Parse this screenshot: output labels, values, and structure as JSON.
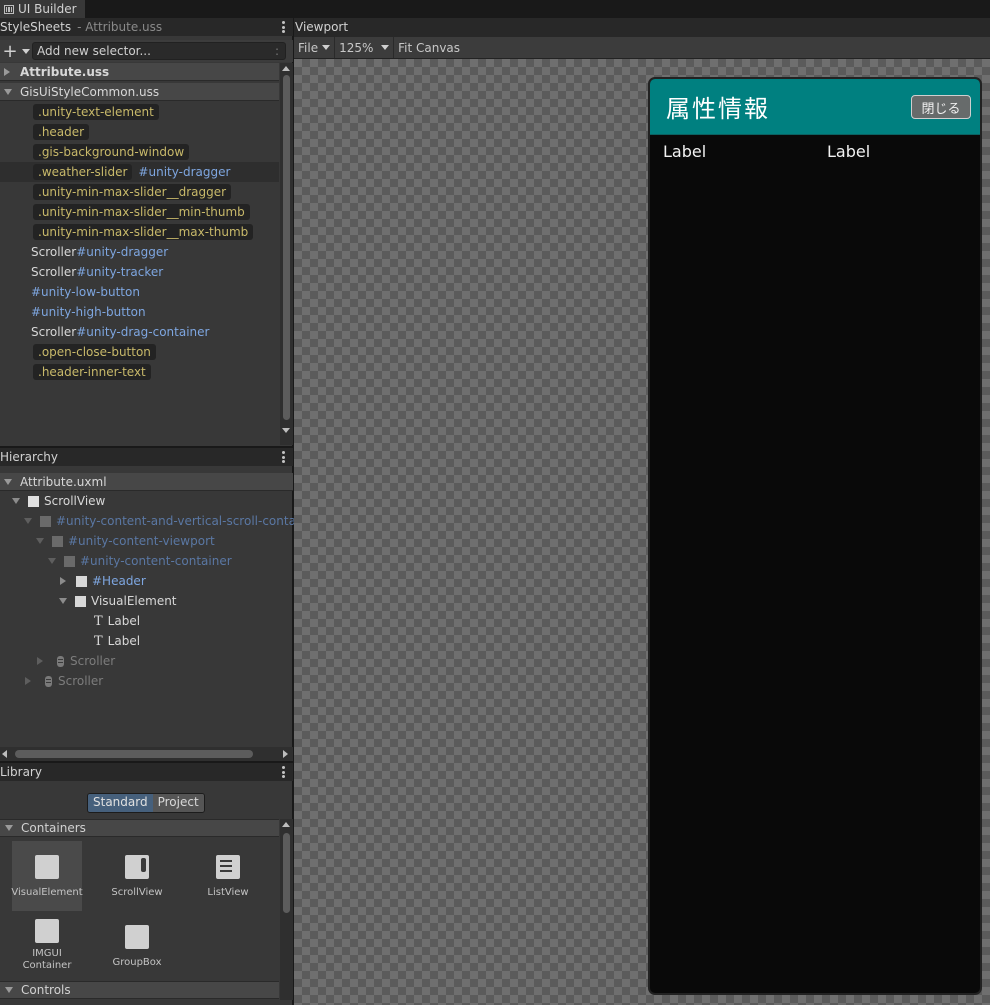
{
  "window": {
    "tab_title": "UI Builder"
  },
  "stylesheets": {
    "header": "StyleSheets",
    "subheader": "- Attribute.uss",
    "add_placeholder": "Add new selector...",
    "sheets": [
      "Attribute.uss",
      "GisUiStyleCommon.uss"
    ],
    "selectors": [
      {
        "cls": ".unity-text-element"
      },
      {
        "cls": ".header"
      },
      {
        "cls": ".gis-background-window"
      },
      {
        "cls": ".weather-slider",
        "id": "#unity-dragger"
      },
      {
        "cls": ".unity-min-max-slider__dragger"
      },
      {
        "cls": ".unity-min-max-slider__min-thumb"
      },
      {
        "cls": ".unity-min-max-slider__max-thumb"
      },
      {
        "type": "Scroller",
        "id": "#unity-dragger"
      },
      {
        "type": "Scroller",
        "id": "#unity-tracker"
      },
      {
        "id": "#unity-low-button"
      },
      {
        "id": "#unity-high-button"
      },
      {
        "type": "Scroller",
        "id": "#unity-drag-container"
      },
      {
        "cls": ".open-close-button"
      },
      {
        "cls": ".header-inner-text"
      }
    ]
  },
  "hierarchy": {
    "header": "Hierarchy",
    "root": "Attribute.uxml",
    "nodes": [
      "ScrollView",
      "#unity-content-and-vertical-scroll-conta",
      "#unity-content-viewport",
      "#unity-content-container",
      "#Header",
      "VisualElement",
      "Label",
      "Label",
      "Scroller",
      "Scroller"
    ]
  },
  "library": {
    "header": "Library",
    "tabs": [
      "Standard",
      "Project"
    ],
    "categories": [
      "Containers",
      "Controls"
    ],
    "items": [
      {
        "label": "VisualElement",
        "icon": "visual-element-icon"
      },
      {
        "label": "ScrollView",
        "icon": "scrollview-icon"
      },
      {
        "label": "ListView",
        "icon": "listview-icon"
      },
      {
        "label": "IMGUI\nContainer",
        "icon": "imgui-container-icon"
      },
      {
        "label": "GroupBox",
        "icon": "groupbox-icon"
      }
    ]
  },
  "viewport": {
    "header": "Viewport",
    "file_menu": "File",
    "zoom": "125%",
    "fit_canvas": "Fit Canvas",
    "canvas": {
      "title": "属性情報",
      "close_button": "閉じる",
      "labels": [
        "Label",
        "Label"
      ],
      "header_color": "#008080"
    }
  }
}
